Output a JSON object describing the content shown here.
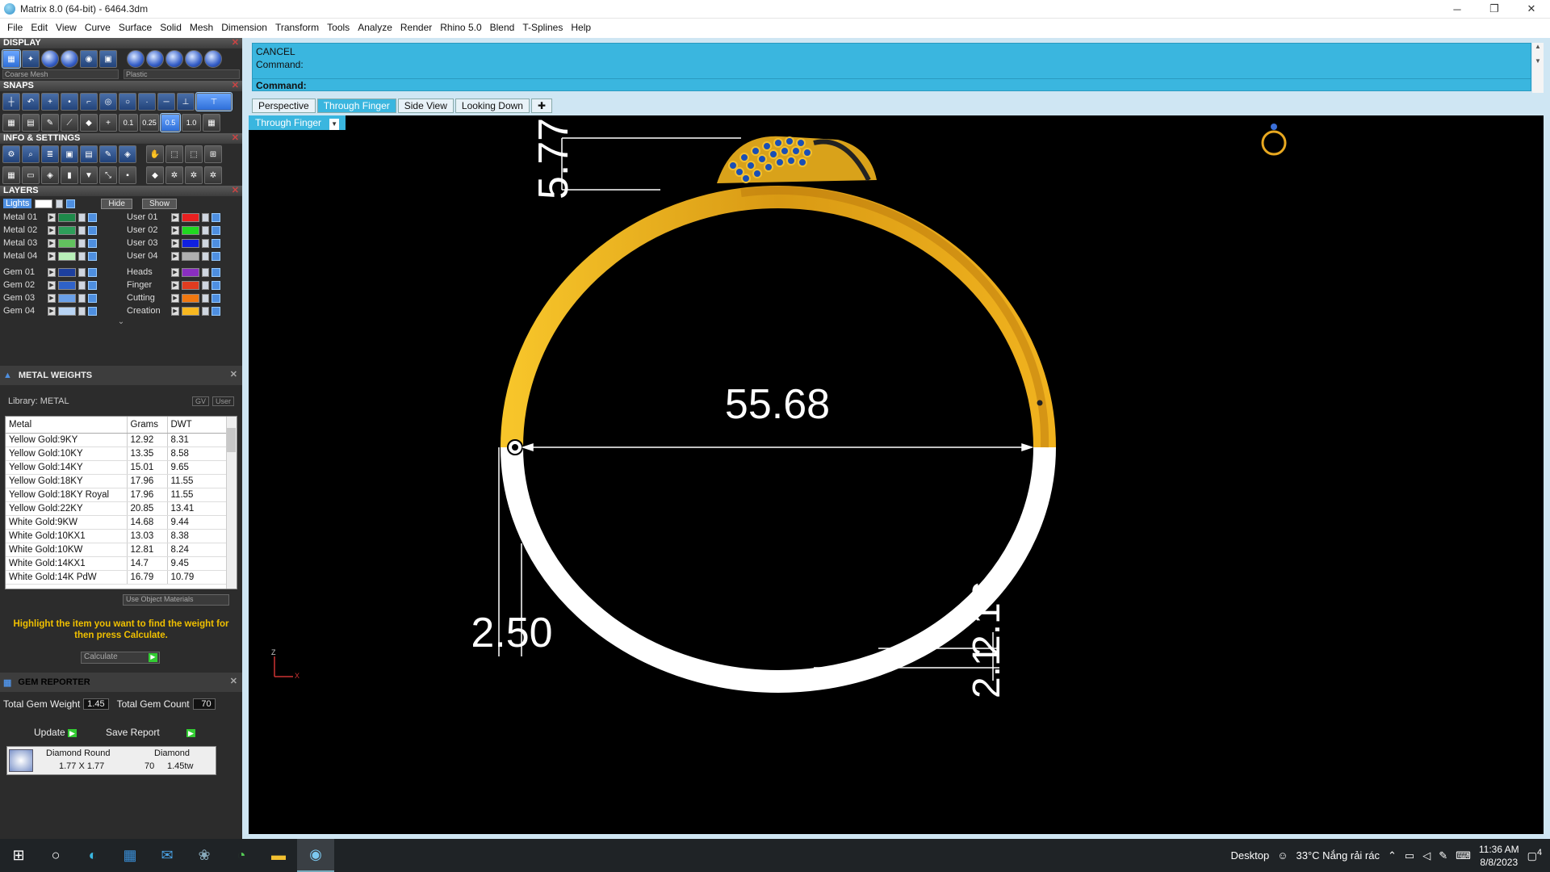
{
  "window": {
    "title": "Matrix 8.0 (64-bit) - 6464.3dm"
  },
  "menu": [
    "File",
    "Edit",
    "View",
    "Curve",
    "Surface",
    "Solid",
    "Mesh",
    "Dimension",
    "Transform",
    "Tools",
    "Analyze",
    "Render",
    "Rhino 5.0",
    "Blend",
    "T-Splines",
    "Help"
  ],
  "panels": {
    "display": {
      "title": "DISPLAY",
      "mesh": "Coarse Mesh",
      "material": "Plastic"
    },
    "snaps": {
      "title": "SNAPS",
      "values": [
        "0.1",
        "0.25",
        "0.5",
        "1.0"
      ]
    },
    "info": {
      "title": "INFO & SETTINGS"
    },
    "layers": {
      "title": "LAYERS",
      "lights": "Lights",
      "hide": "Hide",
      "show": "Show",
      "left": [
        {
          "name": "Metal 01",
          "color": "#1e8a4a"
        },
        {
          "name": "Metal 02",
          "color": "#2e9e5a"
        },
        {
          "name": "Metal 03",
          "color": "#62c25e"
        },
        {
          "name": "Metal 04",
          "color": "#b8f0b8"
        },
        {
          "name": "Gem 01",
          "color": "#1d3f9e"
        },
        {
          "name": "Gem 02",
          "color": "#2f62c8"
        },
        {
          "name": "Gem 03",
          "color": "#6aa0e8"
        },
        {
          "name": "Gem 04",
          "color": "#b8d4f4"
        }
      ],
      "right": [
        {
          "name": "User 01",
          "color": "#e82020"
        },
        {
          "name": "User 02",
          "color": "#20d820"
        },
        {
          "name": "User 03",
          "color": "#1020e0"
        },
        {
          "name": "User 04",
          "color": "#b0b0b0"
        },
        {
          "name": "Heads",
          "color": "#8a2ec0"
        },
        {
          "name": "Finger",
          "color": "#e03c20"
        },
        {
          "name": "Cutting",
          "color": "#f07810"
        },
        {
          "name": "Creation",
          "color": "#f8b820"
        }
      ]
    },
    "metal_weights": {
      "title": "METAL WEIGHTS",
      "library": "Library: METAL",
      "gv": "GV",
      "user": "User",
      "headers": [
        "Metal",
        "Grams",
        "DWT"
      ],
      "rows": [
        [
          "Yellow Gold:9KY",
          "12.92",
          "8.31"
        ],
        [
          "Yellow Gold:10KY",
          "13.35",
          "8.58"
        ],
        [
          "Yellow Gold:14KY",
          "15.01",
          "9.65"
        ],
        [
          "Yellow Gold:18KY",
          "17.96",
          "11.55"
        ],
        [
          "Yellow Gold:18KY Royal",
          "17.96",
          "11.55"
        ],
        [
          "Yellow Gold:22KY",
          "20.85",
          "13.41"
        ],
        [
          "White Gold:9KW",
          "14.68",
          "9.44"
        ],
        [
          "White Gold:10KX1",
          "13.03",
          "8.38"
        ],
        [
          "White Gold:10KW",
          "12.81",
          "8.24"
        ],
        [
          "White Gold:14KX1",
          "14.7",
          "9.45"
        ],
        [
          "White Gold:14K PdW",
          "16.79",
          "10.79"
        ]
      ],
      "use_object_materials": "Use Object Materials",
      "hint": "Highlight the item you want to find the weight for then press Calculate.",
      "calculate": "Calculate"
    },
    "gem_reporter": {
      "title": "GEM REPORTER",
      "total_weight_label": "Total Gem Weight",
      "total_weight": "1.45",
      "total_count_label": "Total Gem Count",
      "total_count": "70",
      "update": "Update",
      "save_report": "Save Report",
      "gem_shape": "Diamond Round",
      "gem_size": "1.77 X 1.77",
      "gem_type": "Diamond",
      "gem_count": "70",
      "gem_tw": "1.45tw"
    }
  },
  "command": {
    "line1": "CANCEL",
    "line2": "Command:",
    "prompt": "Command:"
  },
  "tabs": [
    "Perspective",
    "Through Finger",
    "Side View",
    "Looking Down"
  ],
  "active_tab": "Through Finger",
  "viewport_name": "Through Finger",
  "dimensions": {
    "top": "5.77",
    "diameter": "55.68",
    "thickness_left": "2.50",
    "bottom_a": "2.16",
    "bottom_b": "2.1"
  },
  "axes": {
    "z": "Z",
    "x": "X"
  },
  "taskbar": {
    "desktop": "Desktop",
    "weather": "33°C  Nắng rải rác",
    "time": "11:36 AM",
    "date": "8/8/2023",
    "badge": "4"
  },
  "colors": {
    "cmd": "#3ab6df",
    "gold": "#f2b41c",
    "hint": "#f0c000"
  }
}
